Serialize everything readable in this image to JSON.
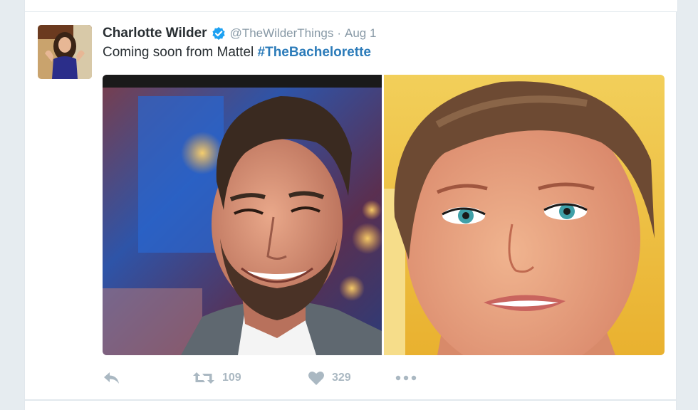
{
  "tweet": {
    "author_name": "Charlotte Wilder",
    "handle": "@TheWilderThings",
    "separator": "·",
    "date": "Aug 1",
    "text": "Coming soon from Mattel ",
    "hashtag": "#TheBachelorette",
    "retweet_count": "109",
    "like_count": "329"
  },
  "icons": {
    "reply": "reply-icon",
    "retweet": "retweet-icon",
    "like": "heart-icon",
    "more": "more-dots-icon",
    "verified": "verified-badge-icon"
  },
  "colors": {
    "background": "#e6ecf0",
    "card": "#ffffff",
    "text": "#292f33",
    "muted": "#8899a6",
    "link": "#2b7bb9",
    "action": "#aab8c2",
    "verified": "#1da1f2"
  }
}
